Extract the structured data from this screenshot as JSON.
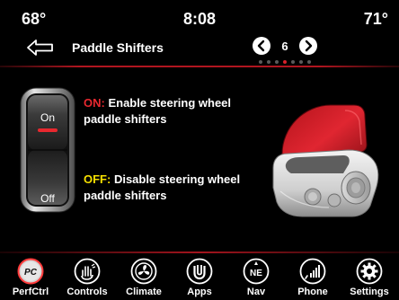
{
  "status": {
    "temp_left": "68°",
    "clock": "8:08",
    "temp_right": "71°"
  },
  "header": {
    "back_icon": "back-arrow-icon",
    "title": "Paddle Shifters",
    "page_number": "6",
    "page_count": 7,
    "active_page_index": 3,
    "prev_icon": "chevron-left-icon",
    "next_icon": "chevron-right-icon"
  },
  "content": {
    "switch": {
      "on_label": "On",
      "off_label": "Off"
    },
    "on": {
      "key": "ON:",
      "text": "Enable steering wheel paddle shifters"
    },
    "off": {
      "key": "OFF:",
      "text": "Disable steering wheel paddle shifters"
    }
  },
  "nav": {
    "items": [
      {
        "label": "PerfCtrl",
        "icon": "perf-control-icon",
        "active": true
      },
      {
        "label": "Controls",
        "icon": "hand-controls-icon",
        "active": false
      },
      {
        "label": "Climate",
        "icon": "climate-fan-icon",
        "active": false
      },
      {
        "label": "Apps",
        "icon": "apps-icon",
        "active": false
      },
      {
        "label": "Nav",
        "icon": "compass-icon",
        "active": false
      },
      {
        "label": "Phone",
        "icon": "phone-signal-icon",
        "active": false
      },
      {
        "label": "Settings",
        "icon": "gear-icon",
        "active": false
      }
    ]
  },
  "colors": {
    "accent_red": "#e8282f",
    "off_yellow": "#f6e000",
    "divider_red": "#b0151f",
    "background": "#000000"
  }
}
